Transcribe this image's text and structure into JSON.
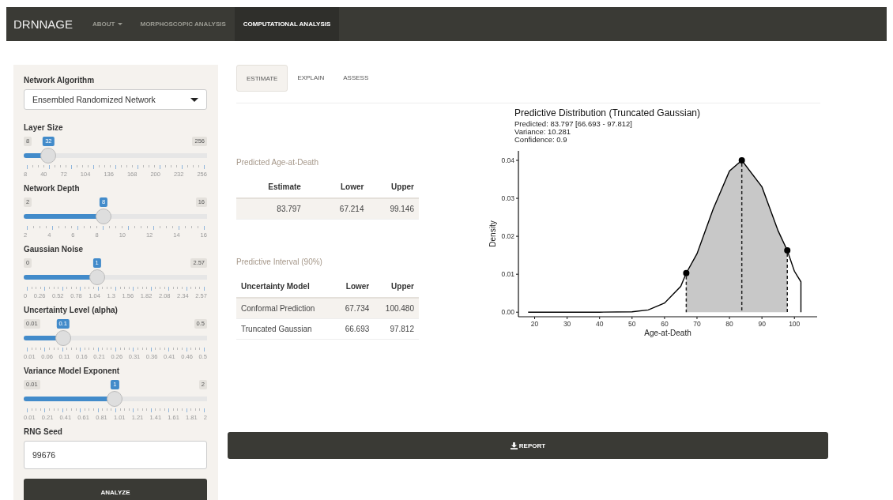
{
  "navbar": {
    "brand": "DRNNAGE",
    "items": [
      {
        "label": "ABOUT",
        "kind": "dropdown",
        "selected": false
      },
      {
        "label": "MORPHOSCOPIC ANALYSIS",
        "kind": "link",
        "selected": false
      },
      {
        "label": "COMPUTATIONAL ANALYSIS",
        "kind": "link",
        "selected": true
      }
    ]
  },
  "sidebar": {
    "algorithm": {
      "label": "Network Algorithm",
      "value": "Ensembled Randomized Network"
    },
    "sliders": [
      {
        "label": "Layer Size",
        "min": "8",
        "max": "256",
        "value": "32",
        "level": 0.097,
        "ticks": [
          "8",
          "40",
          "72",
          "104",
          "136",
          "168",
          "200",
          "232",
          "256"
        ]
      },
      {
        "label": "Network Depth",
        "min": "2",
        "max": "16",
        "value": "8",
        "level": 0.4286,
        "ticks": [
          "2",
          "4",
          "6",
          "8",
          "10",
          "12",
          "14",
          "16"
        ]
      },
      {
        "label": "Gaussian Noise",
        "min": "0",
        "max": "2.57",
        "value": "1",
        "level": 0.389,
        "ticks": [
          "0",
          "0.26",
          "0.52",
          "0.78",
          "1.04",
          "1.3",
          "1.56",
          "1.82",
          "2.08",
          "2.34",
          "2.57"
        ]
      },
      {
        "label": "Uncertainty Level (alpha)",
        "min": "0.01",
        "max": "0.5",
        "value": "0.1",
        "level": 0.184,
        "ticks": [
          "0.01",
          "0.06",
          "0.11",
          "0.16",
          "0.21",
          "0.26",
          "0.31",
          "0.36",
          "0.41",
          "0.46",
          "0.5"
        ]
      },
      {
        "label": "Variance Model Exponent",
        "min": "0.01",
        "max": "2",
        "value": "1",
        "level": 0.497,
        "ticks": [
          "0.01",
          "0.21",
          "0.41",
          "0.61",
          "0.81",
          "1.01",
          "1.21",
          "1.41",
          "1.61",
          "1.81",
          "2"
        ]
      }
    ],
    "seed": {
      "label": "RNG Seed",
      "value": "99676"
    },
    "analyze_button": "ANALYZE"
  },
  "tabs": [
    {
      "label": "ESTIMATE",
      "selected": true
    },
    {
      "label": "EXPLAIN",
      "selected": false
    },
    {
      "label": "ASSESS",
      "selected": false
    }
  ],
  "estimate_table": {
    "caption": "Predicted Age-at-Death",
    "columns": [
      "Estimate",
      "Lower",
      "Upper"
    ],
    "rows": [
      [
        "83.797",
        "67.214",
        "99.146"
      ]
    ]
  },
  "interval_table": {
    "caption": "Predictive Interval (90%)",
    "columns": [
      "Uncertainty Model",
      "Lower",
      "Upper"
    ],
    "rows": [
      [
        "Conformal Prediction",
        "67.734",
        "100.480"
      ],
      [
        "Truncated Gaussian",
        "66.693",
        "97.812"
      ]
    ]
  },
  "plot": {
    "subtitle": [
      "Predicted: 83.797 [66.693 - 97.812]",
      "Variance: 10.281",
      "Confidence: 0.9"
    ],
    "chart_data": {
      "type": "line",
      "title": "Predictive Distribution (Truncated Gaussian)",
      "xlabel": "Age-at-Death",
      "ylabel": "Density",
      "x": [
        18,
        30,
        40,
        50,
        55,
        60,
        65,
        66.693,
        70,
        75,
        80,
        83.797,
        90,
        95,
        97.812,
        100,
        102,
        102
      ],
      "series": [
        {
          "color": "#000000",
          "values": [
            0,
            0,
            0,
            0.0001,
            0.0006,
            0.0024,
            0.0068,
            0.0103,
            0.0154,
            0.0272,
            0.0372,
            0.04,
            0.033,
            0.0214,
            0.0163,
            0.0108,
            0.008,
            0
          ]
        }
      ],
      "xlim": [
        15,
        107
      ],
      "ylim": [
        -0.0012,
        0.0425
      ],
      "xticks": [
        20,
        30,
        40,
        50,
        60,
        70,
        80,
        90,
        100
      ],
      "yticks": [
        {
          "value": 0,
          "label": "0.00"
        },
        {
          "value": 0.01,
          "label": "0.01"
        },
        {
          "value": 0.02,
          "label": "0.02"
        },
        {
          "value": 0.03,
          "label": "0.03"
        },
        {
          "value": 0.04,
          "label": "0.04"
        }
      ],
      "ref_lines": [
        {
          "axis": "x",
          "value": 66.693
        },
        {
          "axis": "x",
          "value": 83.797
        },
        {
          "axis": "x",
          "value": 97.812
        }
      ]
    }
  },
  "report_button": "REPORT"
}
